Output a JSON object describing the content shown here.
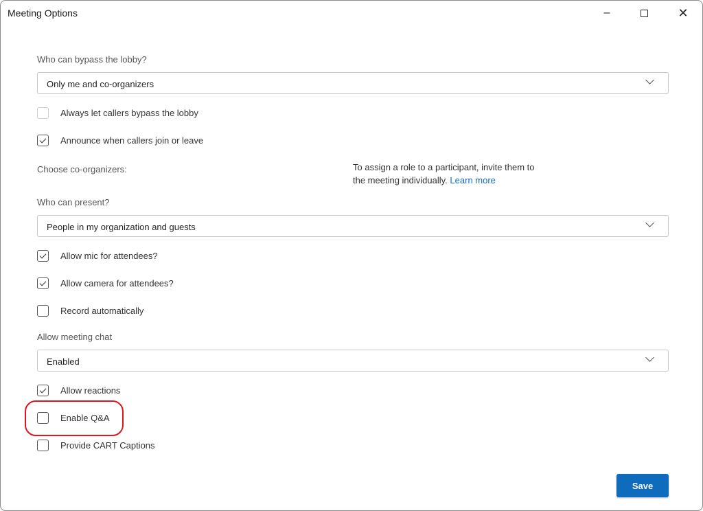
{
  "window": {
    "title": "Meeting Options"
  },
  "lobby": {
    "label": "Who can bypass the lobby?",
    "value": "Only me and co-organizers"
  },
  "checks1": [
    {
      "label": "Always let callers bypass the lobby",
      "checked": false,
      "disabled": true
    },
    {
      "label": "Announce when callers join or leave",
      "checked": true,
      "disabled": false
    }
  ],
  "coorg": {
    "label": "Choose co-organizers:",
    "info": "To assign a role to a participant, invite them to the meeting individually.",
    "link": "Learn more"
  },
  "present": {
    "label": "Who can present?",
    "value": "People in my organization and guests"
  },
  "checks2": [
    {
      "label": "Allow mic for attendees?",
      "checked": true
    },
    {
      "label": "Allow camera for attendees?",
      "checked": true
    },
    {
      "label": "Record automatically",
      "checked": false
    }
  ],
  "chat": {
    "label": "Allow meeting chat",
    "value": "Enabled"
  },
  "checks3": [
    {
      "label": "Allow reactions",
      "checked": true
    },
    {
      "label": "Enable Q&A",
      "checked": false
    },
    {
      "label": "Provide CART Captions",
      "checked": false
    }
  ],
  "save_label": "Save",
  "colors": {
    "accent": "#0f6cbd",
    "annotation": "#e0141e"
  }
}
